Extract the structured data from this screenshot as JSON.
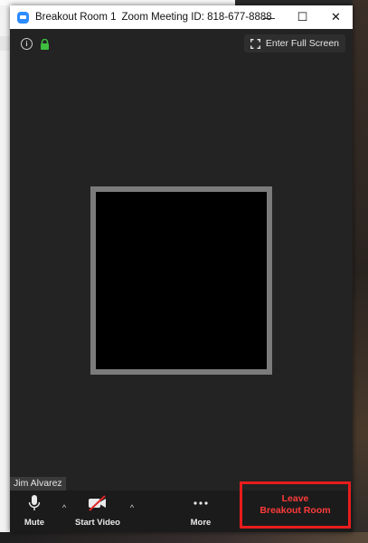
{
  "window": {
    "room_title": "Breakout Room 1",
    "meeting_id_text": "Zoom Meeting ID: 818-677-8888",
    "minimize_glyph": "—",
    "maximize_glyph": "☐",
    "close_glyph": "✕"
  },
  "header": {
    "fullscreen_label": "Enter Full Screen",
    "lock_color": "#3fbf3f"
  },
  "participant": {
    "name": "Jim Alvarez"
  },
  "toolbar": {
    "mute_label": "Mute",
    "start_video_label": "Start Video",
    "more_label": "More",
    "leave_line1": "Leave",
    "leave_line2": "Breakout Room",
    "leave_color": "#ff3b3b",
    "highlight_color": "#e81c1c"
  },
  "icons": [
    "zoom-app-icon",
    "info-icon",
    "lock-icon",
    "fullscreen-icon",
    "microphone-icon",
    "video-off-icon",
    "more-dots-icon",
    "caret-up-icon"
  ]
}
